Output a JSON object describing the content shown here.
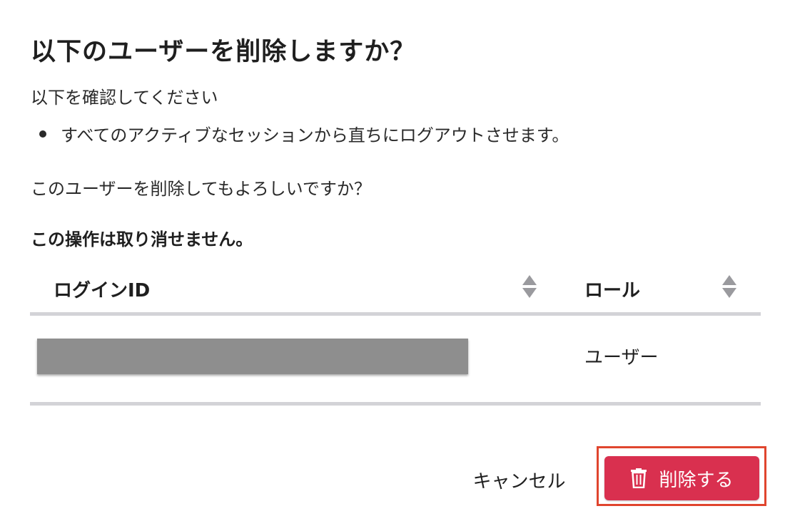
{
  "dialog": {
    "title": "以下のユーザーを削除しますか？",
    "intro": "以下を確認してください",
    "bullets": [
      "すべてのアクティブなセッションから直ちにログアウトさせます。"
    ],
    "question": "このユーザーを削除してもよろしいですか？",
    "warning": "この操作は取り消せません。"
  },
  "table": {
    "columns": [
      {
        "label": "ログインID",
        "sortable": true,
        "sort_icon": "sort-icon"
      },
      {
        "label": "ロール",
        "sortable": true,
        "sort_icon": "sort-icon"
      }
    ],
    "rows": [
      {
        "login_id": "",
        "login_id_redacted": true,
        "role": "ユーザー"
      }
    ]
  },
  "footer": {
    "cancel_label": "キャンセル",
    "delete_label": "削除する",
    "delete_icon": "trash-icon",
    "delete_color": "#d9304f",
    "highlight_color": "#e0452e"
  }
}
